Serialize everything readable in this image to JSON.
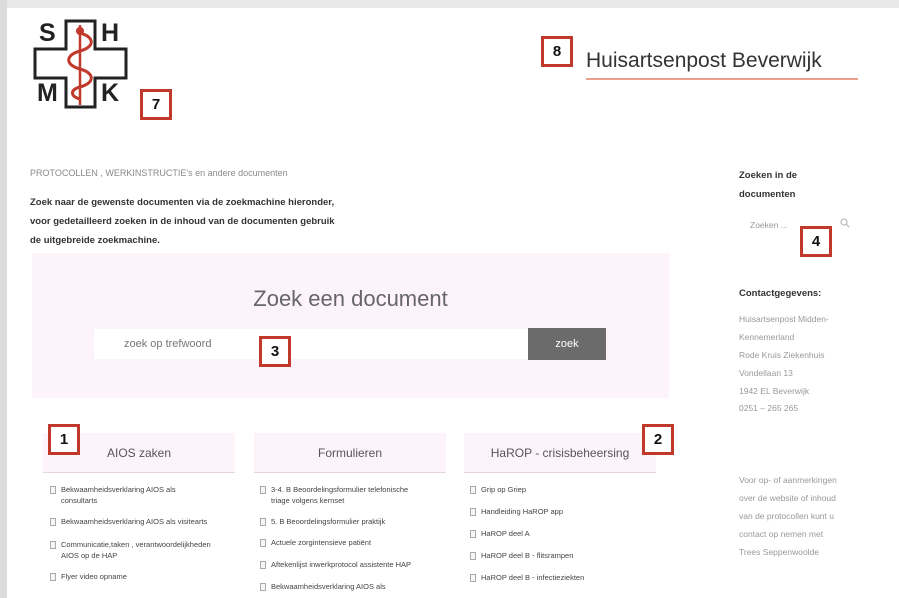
{
  "logo": {
    "letters": [
      "S",
      "H",
      "M",
      "K"
    ],
    "cross_color": "#222222",
    "snake_color": "#c0392b"
  },
  "site_title": "Huisartsenpost Beverwijk",
  "accent_color": "#e8a08f",
  "markers": [
    "7",
    "8",
    "4",
    "3",
    "1",
    "2"
  ],
  "breadcrumb": "PROTOCOLLEN , WERKINSTRUCTIE's en andere documenten",
  "intro": [
    "Zoek naar de gewenste documenten via de zoekmachine hieronder,",
    "voor gedetailleerd zoeken in de inhoud van de documenten gebruik",
    "de uitgebreide zoekmachine."
  ],
  "search": {
    "heading": "Zoek een document",
    "placeholder": "zoek op trefwoord",
    "button": "zoek"
  },
  "sidebar": {
    "search_heading": [
      "Zoeken in de",
      "documenten"
    ],
    "search_placeholder": "Zoeken ...",
    "contact_heading": "Contactgegevens:",
    "contact_lines": [
      "Huisartsenpost Midden-",
      "Kennemerland",
      "Rode Kruis Ziekenhuis",
      "Vondellaan 13",
      "1942 EL Beverwijk",
      "0251 – 265 265"
    ],
    "note_lines": [
      "Voor op- of aanmerkingen",
      "over de website of inhoud",
      "van de protocollen kunt u",
      "contact op nemen met",
      "Trees Seppenwoolde"
    ]
  },
  "categories": [
    {
      "title": "AIOS zaken",
      "items": [
        [
          "Bekwaamheidsverklaring AIOS als",
          "consultarts"
        ],
        [
          "Bekwaamheidsverklaring AIOS als visitearts"
        ],
        [
          "Communicatie,taken , verantwoordelijkheden",
          "AIOS op de HAP"
        ],
        [
          "Flyer video opname"
        ]
      ]
    },
    {
      "title": "Formulieren",
      "items": [
        [
          "3-4. B Beoordelingsformulier telefonische",
          "triage volgens kernset"
        ],
        [
          "5. B Beoordelingsformulier praktijk"
        ],
        [
          "Actuele zorgintensieve patiënt"
        ],
        [
          "Aftekenlijst inwerkprotocol assistente HAP"
        ],
        [
          "Bekwaamheidsverklaring AIOS als"
        ]
      ]
    },
    {
      "title": "HaROP - crisisbeheersing",
      "items": [
        [
          "Grip op Griep"
        ],
        [
          "Handleiding HaROP app"
        ],
        [
          "HaROP deel A"
        ],
        [
          "HaROP deel B - flitsrampen"
        ],
        [
          "HaROP deel B - infectieziekten"
        ]
      ]
    }
  ]
}
